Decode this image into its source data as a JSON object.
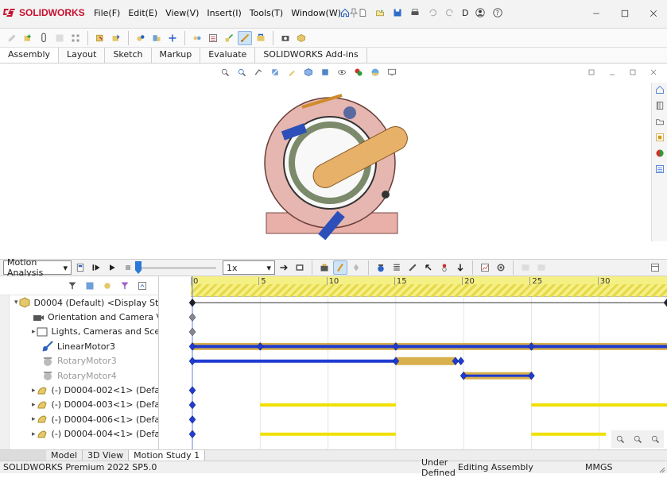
{
  "app": {
    "brand": "SOLIDWORKS",
    "menu": [
      "File(F)",
      "Edit(E)",
      "View(V)",
      "Insert(I)",
      "Tools(T)",
      "Window(W)"
    ],
    "doc_short": "D",
    "pin": "pin"
  },
  "tabs": [
    "Assembly",
    "Layout",
    "Sketch",
    "Markup",
    "Evaluate",
    "SOLIDWORKS Add-ins"
  ],
  "motion": {
    "study_type": "Motion Analysis",
    "speed": "1x"
  },
  "tree": [
    {
      "label": "D0004 (Default) <Display Sta",
      "icon": "assembly-icon",
      "indent": 1,
      "arrow": "down",
      "gray": false
    },
    {
      "label": "Orientation and Camera Views",
      "icon": "camera-icon",
      "indent": 2,
      "arrow": "",
      "gray": false
    },
    {
      "label": "Lights, Cameras and Sce",
      "icon": "light-icon",
      "indent": 2,
      "arrow": "right",
      "gray": false
    },
    {
      "label": "LinearMotor3",
      "icon": "linear-motor-icon",
      "indent": 2,
      "arrow": "",
      "gray": false
    },
    {
      "label": "RotaryMotor3",
      "icon": "rotary-motor-icon",
      "indent": 2,
      "arrow": "",
      "gray": true
    },
    {
      "label": "RotaryMotor4",
      "icon": "rotary-motor-icon",
      "indent": 2,
      "arrow": "",
      "gray": true
    },
    {
      "label": "(-) D0004-002<1> (Defa",
      "icon": "part-icon",
      "indent": 2,
      "arrow": "right",
      "gray": false
    },
    {
      "label": "(-) D0004-003<1> (Defa",
      "icon": "part-icon",
      "indent": 2,
      "arrow": "right",
      "gray": false
    },
    {
      "label": "(-) D0004-006<1> (Defa",
      "icon": "part-icon",
      "indent": 2,
      "arrow": "right",
      "gray": false
    },
    {
      "label": "(-) D0004-004<1> (Defa",
      "icon": "part-icon",
      "indent": 2,
      "arrow": "right",
      "gray": false
    }
  ],
  "timeline": {
    "ticks": [
      "0",
      "5",
      "10",
      "15",
      "20",
      "25",
      "30"
    ],
    "time_max": 35
  },
  "bottom_tabs": [
    "Model",
    "3D View",
    "Motion Study 1"
  ],
  "status": {
    "product": "SOLIDWORKS Premium 2022 SP5.0",
    "state1": "Under Defined",
    "state2": "Editing Assembly",
    "units": "MMGS"
  },
  "colors": {
    "brand": "#c8102e",
    "accent": "#2a79d4",
    "ruler": "#f5f084",
    "blue_bar": "#1f3bd1",
    "gold_bar": "#d8b04c",
    "yellow_bar": "#f0e000"
  }
}
